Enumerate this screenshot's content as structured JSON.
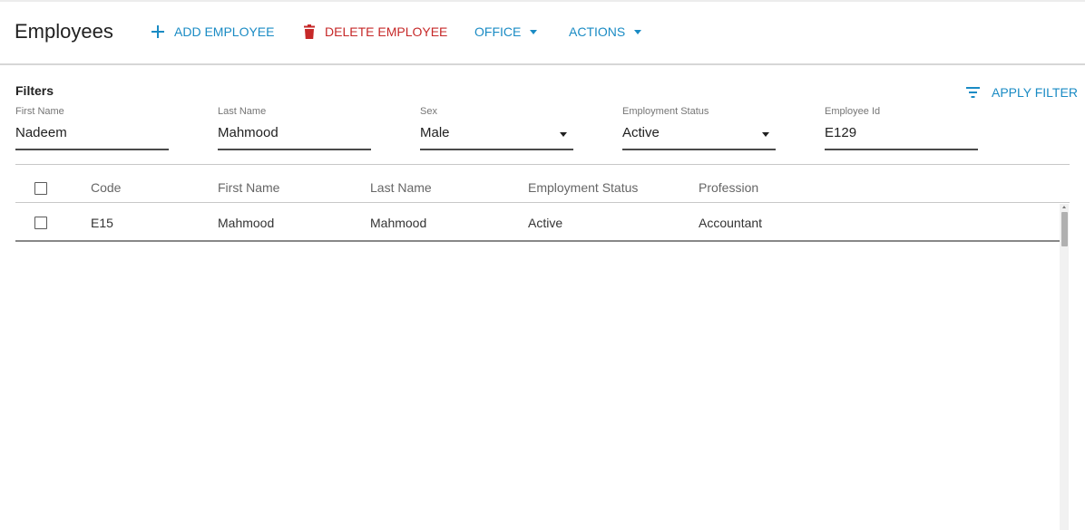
{
  "header": {
    "title": "Employees",
    "add_label": "ADD EMPLOYEE",
    "delete_label": "DELETE EMPLOYEE",
    "office_label": "OFFICE",
    "actions_label": "ACTIONS"
  },
  "filters": {
    "title": "Filters",
    "apply_label": "APPLY FILTER",
    "fields": [
      {
        "label": "First Name",
        "value": "Nadeem"
      },
      {
        "label": "Last Name",
        "value": "Mahmood"
      },
      {
        "label": "Sex",
        "value": "Male"
      },
      {
        "label": "Employment Status",
        "value": "Active"
      },
      {
        "label": "Employee Id",
        "value": "E129"
      }
    ]
  },
  "table": {
    "columns": [
      "Code",
      "First Name",
      "Last Name",
      "Employment Status",
      "Profession"
    ],
    "rows": [
      {
        "code": "E15",
        "first_name": "Mahmood",
        "last_name": "Mahmood",
        "employment_status": "Active",
        "profession": "Accountant"
      }
    ]
  },
  "colors": {
    "accent": "#1a8bc4",
    "danger": "#c62828"
  },
  "icons": {
    "add": "plus-icon",
    "delete": "trash-icon",
    "dropdown": "caret-down-icon",
    "filter": "filter-lines-icon"
  }
}
